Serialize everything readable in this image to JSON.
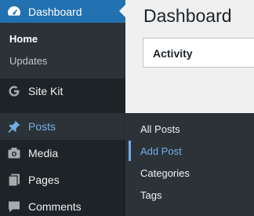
{
  "sidebar": {
    "dashboard": {
      "label": "Dashboard",
      "icon": "dashboard-gauge-icon"
    },
    "dashboard_submenu": [
      {
        "label": "Home",
        "current": true
      },
      {
        "label": "Updates"
      }
    ],
    "items": [
      {
        "label": "Site Kit",
        "icon": "google-g-icon"
      },
      {
        "label": "Posts",
        "icon": "pushpin-icon",
        "open": true
      },
      {
        "label": "Media",
        "icon": "media-camera-icon"
      },
      {
        "label": "Pages",
        "icon": "pages-icon"
      },
      {
        "label": "Comments",
        "icon": "comment-bubble-icon"
      }
    ]
  },
  "posts_flyout": [
    {
      "label": "All Posts"
    },
    {
      "label": "Add Post",
      "active": true
    },
    {
      "label": "Categories"
    },
    {
      "label": "Tags"
    }
  ],
  "main": {
    "page_title": "Dashboard",
    "widgets": [
      {
        "title": "Activity"
      }
    ]
  },
  "colors": {
    "sidebar_bg": "#1d2327",
    "submenu_bg": "#2c3338",
    "accent": "#2271b1",
    "highlight_text": "#72aee6",
    "content_bg": "#f0f0f1"
  }
}
